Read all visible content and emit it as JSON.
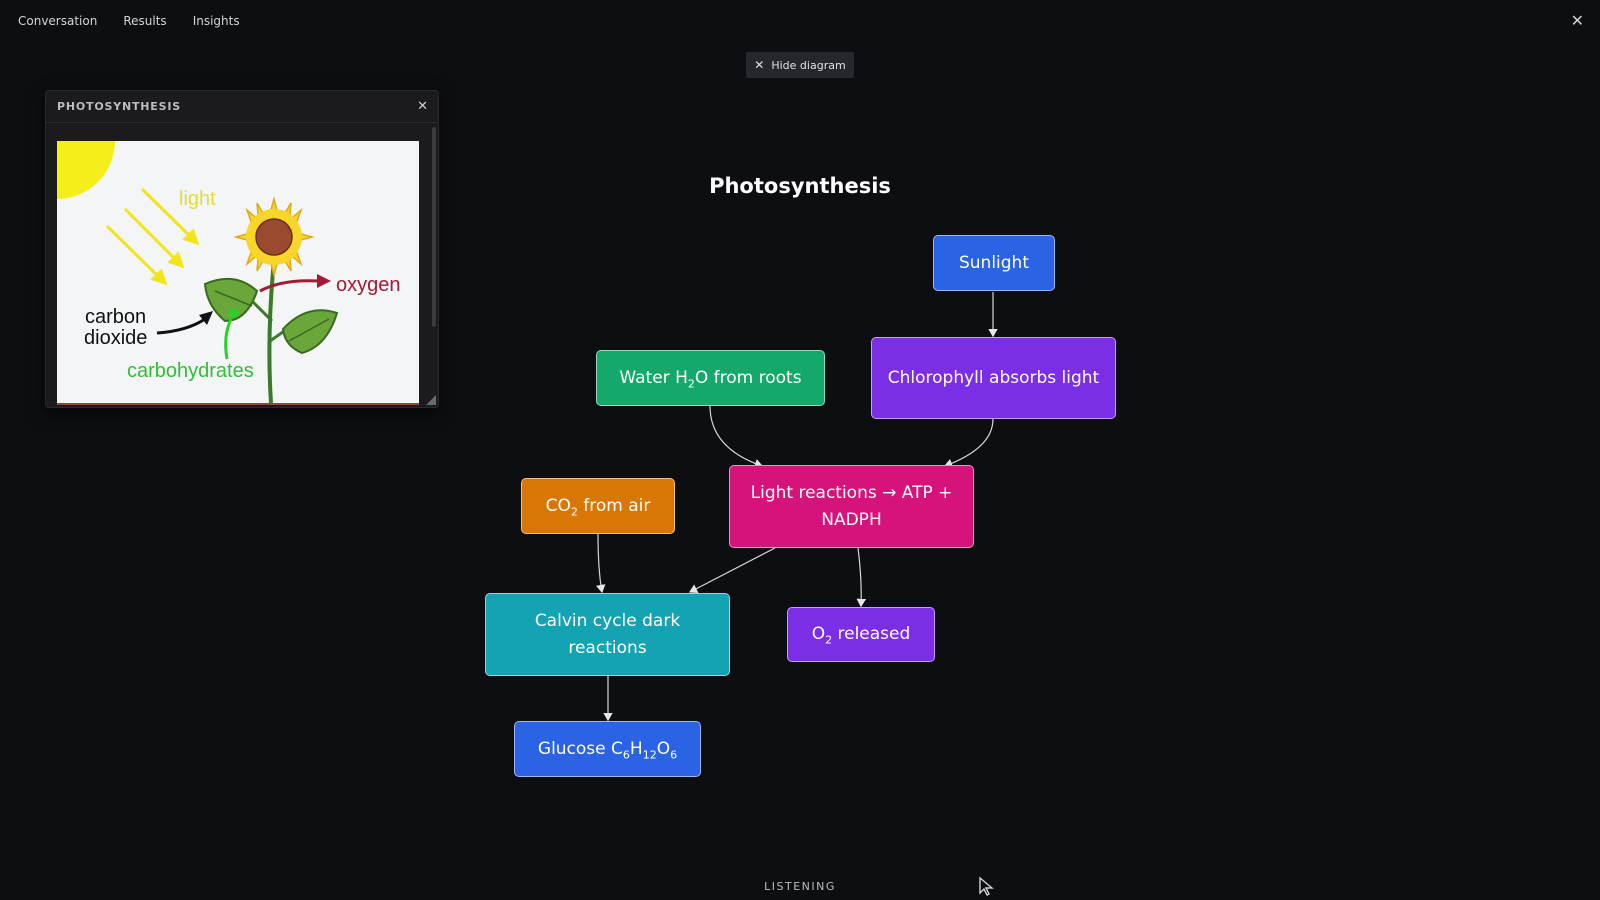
{
  "nav": {
    "tabs": [
      "Conversation",
      "Results",
      "Insights"
    ]
  },
  "hide_diagram_label": "Hide diagram",
  "panel": {
    "title": "PHOTOSYNTHESIS",
    "image_labels": {
      "light": "light",
      "oxygen": "oxygen",
      "carbon": "carbon",
      "dioxide": "dioxide",
      "carbohydrates": "carbohydrates"
    }
  },
  "diagram": {
    "title": "Photosynthesis",
    "nodes": {
      "sunlight": {
        "label": "Sunlight",
        "color": "#2a63e4"
      },
      "chlorophyll": {
        "label": "Chlorophyll absorbs light",
        "color": "#7a2ee6"
      },
      "water": {
        "label_pre": "Water H",
        "sub": "2",
        "label_post": "O from roots",
        "color": "#14a86a"
      },
      "light_reactions": {
        "label": "Light reactions → ATP + NADPH",
        "color": "#d6137a"
      },
      "co2": {
        "label_pre": "CO",
        "sub": "2",
        "label_post": " from air",
        "color": "#d97706"
      },
      "calvin": {
        "label": "Calvin cycle dark reactions",
        "color": "#13a3b3"
      },
      "o2": {
        "label_pre": "O",
        "sub": "2",
        "label_post": " released",
        "color": "#7a2ee6"
      },
      "glucose": {
        "label_pre": "Glucose C",
        "sub1": "6",
        "mid1": "H",
        "sub2": "12",
        "mid2": "O",
        "sub3": "6",
        "color": "#2a63e4"
      }
    }
  },
  "status": "LISTENING"
}
